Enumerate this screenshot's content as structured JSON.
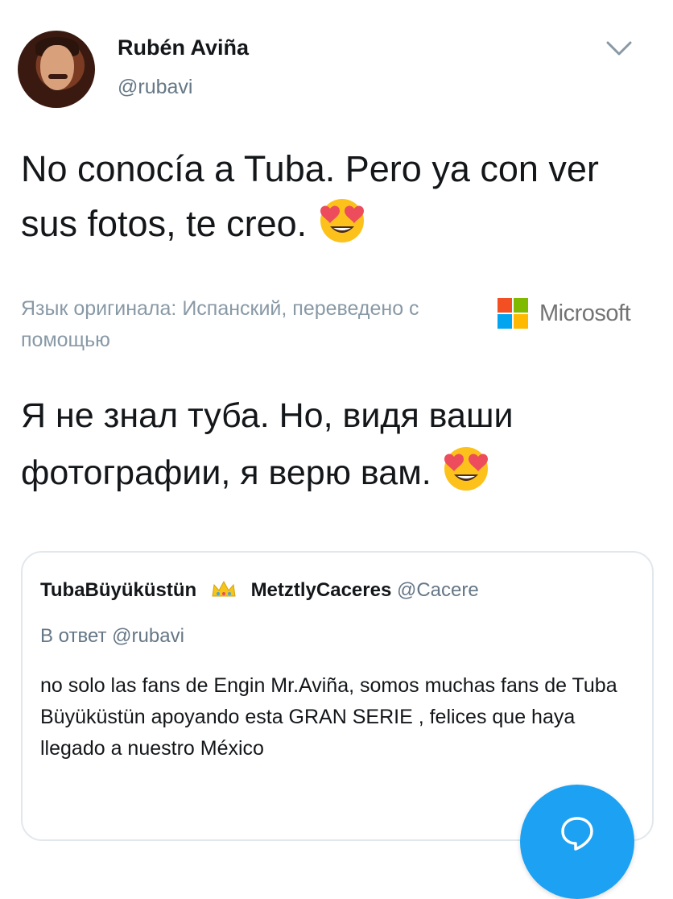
{
  "author": {
    "name": "Rubén Aviña",
    "handle": "@rubavi"
  },
  "tweet": {
    "text": "No conocía a Tuba. Pero ya con ver sus fotos, te creo.",
    "emoji": "heart-eyes-emoji"
  },
  "translation": {
    "source_label": "Язык оригинала: Испанский, переведено  с помощью",
    "provider": "Microsoft",
    "text": "Я не знал туба. Но, видя ваши фотографии, я верю вам."
  },
  "quoted_tweet": {
    "name": "TubaBüyüküstün",
    "badge": "crown-emoji",
    "second_name": "MetztlyCaceres",
    "handle": "@Cacere",
    "reply_to": "В ответ @rubavi",
    "text": "no solo las fans de Engin Mr.Aviña, somos muchas fans de Tuba Büyüküstün apoyando esta GRAN SERIE , felices que haya llegado a nuestro México"
  },
  "colors": {
    "accent": "#1da1f2",
    "secondary_text": "#657786",
    "ms_red": "#f25022",
    "ms_green": "#7fba00",
    "ms_blue": "#00a4ef",
    "ms_yellow": "#ffb900"
  },
  "icons": {
    "menu": "chevron-down-icon",
    "fab": "reply-bubble-icon"
  }
}
